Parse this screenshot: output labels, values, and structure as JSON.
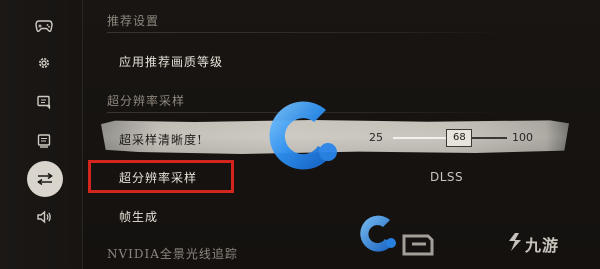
{
  "sidebar": {
    "items": [
      {
        "icon": "gamepad-icon",
        "active": false
      },
      {
        "icon": "gear-icon",
        "active": false
      },
      {
        "icon": "chat-icon",
        "active": false
      },
      {
        "icon": "display-icon",
        "active": false
      },
      {
        "icon": "sliders-icon",
        "active": true
      },
      {
        "icon": "speaker-icon",
        "active": false
      }
    ]
  },
  "sections": {
    "recommended_header": "推荐设置",
    "apply_recommended": "应用推荐画质等级",
    "super_sampling_header": "超分辨率采样",
    "sharpness_label": "超采样清晰度!",
    "sharpness_min": "25",
    "sharpness_max": "100",
    "sharpness_value": "68",
    "upscaling_label": "超分辨率采样",
    "upscaling_value": "DLSS",
    "frame_gen_label": "帧生成",
    "rt_header": "NVIDIA全景光线追踪"
  },
  "watermark": {
    "brand_text": "九游"
  },
  "colors": {
    "highlight_red": "#d3241e",
    "watermark_blue": "#1f7fe6",
    "watermark_blue_light": "#5fb6ff"
  }
}
